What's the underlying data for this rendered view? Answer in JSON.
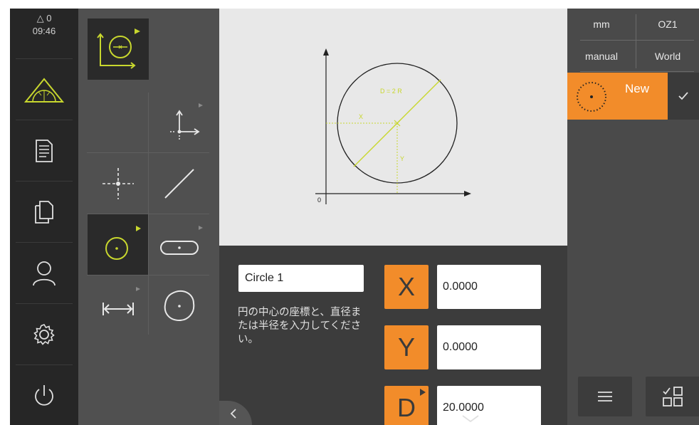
{
  "status": {
    "counter": "0",
    "time": "09:46"
  },
  "main_menu": [
    {
      "name": "measure",
      "icon": "protractor-triangle-icon"
    },
    {
      "name": "measurement-report",
      "icon": "report-icon"
    },
    {
      "name": "file-management",
      "icon": "files-icon"
    },
    {
      "name": "user-login",
      "icon": "user-icon"
    },
    {
      "name": "settings",
      "icon": "gear-icon"
    },
    {
      "name": "switch-off",
      "icon": "power-icon"
    }
  ],
  "palette": {
    "manual_tool_icon": "circle-tool-icon",
    "items": [
      "coordinate-system-icon",
      "point-icon",
      "line-icon",
      "circle-icon",
      "slot-icon",
      "distance-icon",
      "blob-icon"
    ]
  },
  "preview": {
    "diameter_label": "D = 2 R",
    "x_label": "X",
    "y_label": "Y",
    "origin_label": "0"
  },
  "input": {
    "name_value": "Circle 1",
    "instruction": "円の中心の座標と、直径または半径を入力してください。",
    "coords": [
      {
        "label": "X",
        "value": "0.0000"
      },
      {
        "label": "Y",
        "value": "0.0000"
      },
      {
        "label": "D",
        "value": "20.0000"
      }
    ]
  },
  "inspector": {
    "unit": "mm",
    "zero_point": "OZ1",
    "mode": "manual",
    "reference": "World",
    "new_feature_label": "New"
  },
  "colors": {
    "accent": "#f28c2a",
    "highlight": "#c8d72e"
  }
}
